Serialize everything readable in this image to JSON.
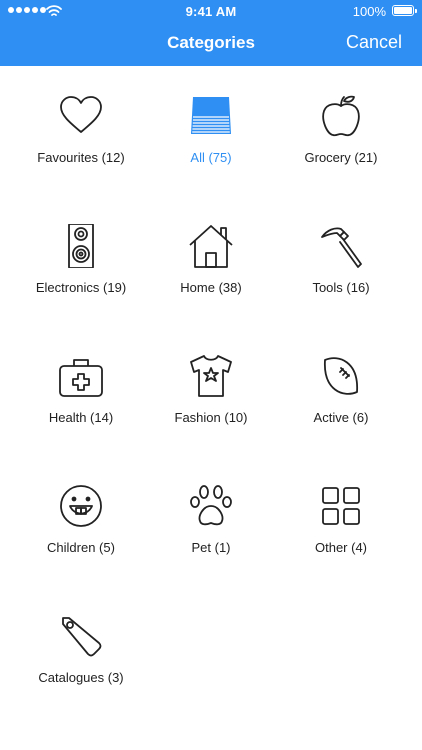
{
  "status_bar": {
    "time": "9:41 AM",
    "battery": "100%"
  },
  "nav": {
    "title": "Categories",
    "cancel_label": "Cancel"
  },
  "colors": {
    "accent": "#2f8ff2",
    "icon_stroke": "#222222",
    "text": "#222222"
  },
  "categories": [
    {
      "label": "Favourites (12)",
      "icon": "heart-icon"
    },
    {
      "label": "All (75)",
      "icon": "stack-icon",
      "selected": true
    },
    {
      "label": "Grocery (21)",
      "icon": "apple-icon"
    },
    {
      "label": "Electronics (19)",
      "icon": "speaker-icon"
    },
    {
      "label": "Home (38)",
      "icon": "house-icon"
    },
    {
      "label": "Tools (16)",
      "icon": "hammer-icon"
    },
    {
      "label": "Health (14)",
      "icon": "first-aid-icon"
    },
    {
      "label": "Fashion (10)",
      "icon": "tshirt-icon"
    },
    {
      "label": "Active (6)",
      "icon": "football-icon"
    },
    {
      "label": "Children (5)",
      "icon": "smiley-icon"
    },
    {
      "label": "Pet (1)",
      "icon": "paw-icon"
    },
    {
      "label": "Other (4)",
      "icon": "grid-icon"
    },
    {
      "label": "Catalogues (3)",
      "icon": "tag-icon"
    }
  ]
}
